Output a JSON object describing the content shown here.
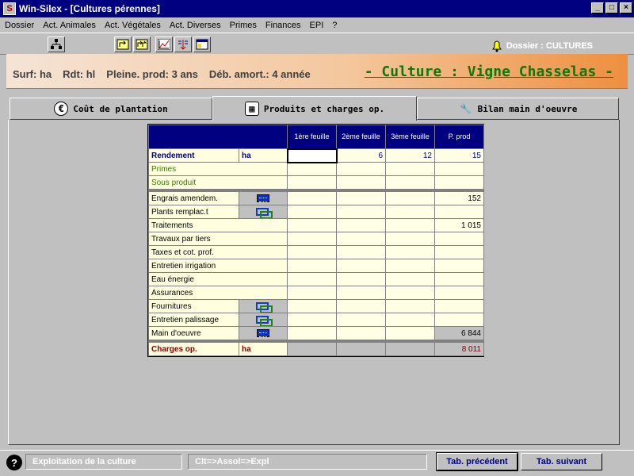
{
  "window": {
    "title": "Win-Silex - [Cultures pérennes]"
  },
  "menu": [
    "Dossier",
    "Act. Animales",
    "Act. Végétales",
    "Act. Diverses",
    "Primes",
    "Finances",
    "EPI",
    "?"
  ],
  "toolbar": {
    "dossier_label": "Dossier : CULTURES"
  },
  "header": {
    "surf": "Surf: ha",
    "rdt": "Rdt: hl",
    "pleine": "Pleine. prod: 3 ans",
    "deb": "Déb. amort.: 4 année",
    "culture": "- Culture : Vigne Chasselas -"
  },
  "tabs": [
    {
      "label": "Coût de plantation",
      "icon": "euro-icon"
    },
    {
      "label": "Produits et charges op.",
      "icon": "calculator-icon"
    },
    {
      "label": "Bilan main d'oeuvre",
      "icon": "wrench-icon"
    }
  ],
  "grid": {
    "headers": [
      "1ère feuille",
      "2ème feuille",
      "3ème feuille",
      "P. prod"
    ],
    "rendement": {
      "label": "Rendement",
      "unit": "ha",
      "values": [
        "",
        "6",
        "12",
        "15"
      ]
    },
    "primes": "Primes",
    "sous_produit": "Sous produit",
    "rows": [
      {
        "label": "Engrais amendem.",
        "icon": "calculator-icon",
        "values": [
          "",
          "",
          "",
          "152"
        ]
      },
      {
        "label": "Plants remplac.t",
        "icon": "link-icon",
        "values": [
          "",
          "",
          "",
          ""
        ]
      },
      {
        "label": "Traitements",
        "icon": "",
        "values": [
          "",
          "",
          "",
          "1 015"
        ]
      },
      {
        "label": "Travaux par tiers",
        "icon": "",
        "values": [
          "",
          "",
          "",
          ""
        ]
      },
      {
        "label": "Taxes et cot. prof.",
        "icon": "",
        "values": [
          "",
          "",
          "",
          ""
        ]
      },
      {
        "label": "Entretien irrigation",
        "icon": "",
        "values": [
          "",
          "",
          "",
          ""
        ]
      },
      {
        "label": "Eau énergie",
        "icon": "",
        "values": [
          "",
          "",
          "",
          ""
        ]
      },
      {
        "label": "Assurances",
        "icon": "",
        "values": [
          "",
          "",
          "",
          ""
        ]
      },
      {
        "label": "Fournitures",
        "icon": "link-icon",
        "values": [
          "",
          "",
          "",
          ""
        ]
      },
      {
        "label": "Entretien palissage",
        "icon": "link-icon",
        "values": [
          "",
          "",
          "",
          ""
        ]
      },
      {
        "label": "Main d'oeuvre",
        "icon": "calculator-icon",
        "values": [
          "",
          "",
          "",
          "6 844"
        ]
      }
    ],
    "charges": {
      "label": "Charges op.",
      "unit": "ha",
      "values": [
        "",
        "",
        "",
        "8 011"
      ]
    }
  },
  "status": {
    "field1": "Exploitation de la culture",
    "field2": "Clt=>Assol=>Expl",
    "prev": "Tab. précédent",
    "next": "Tab. suivant"
  }
}
